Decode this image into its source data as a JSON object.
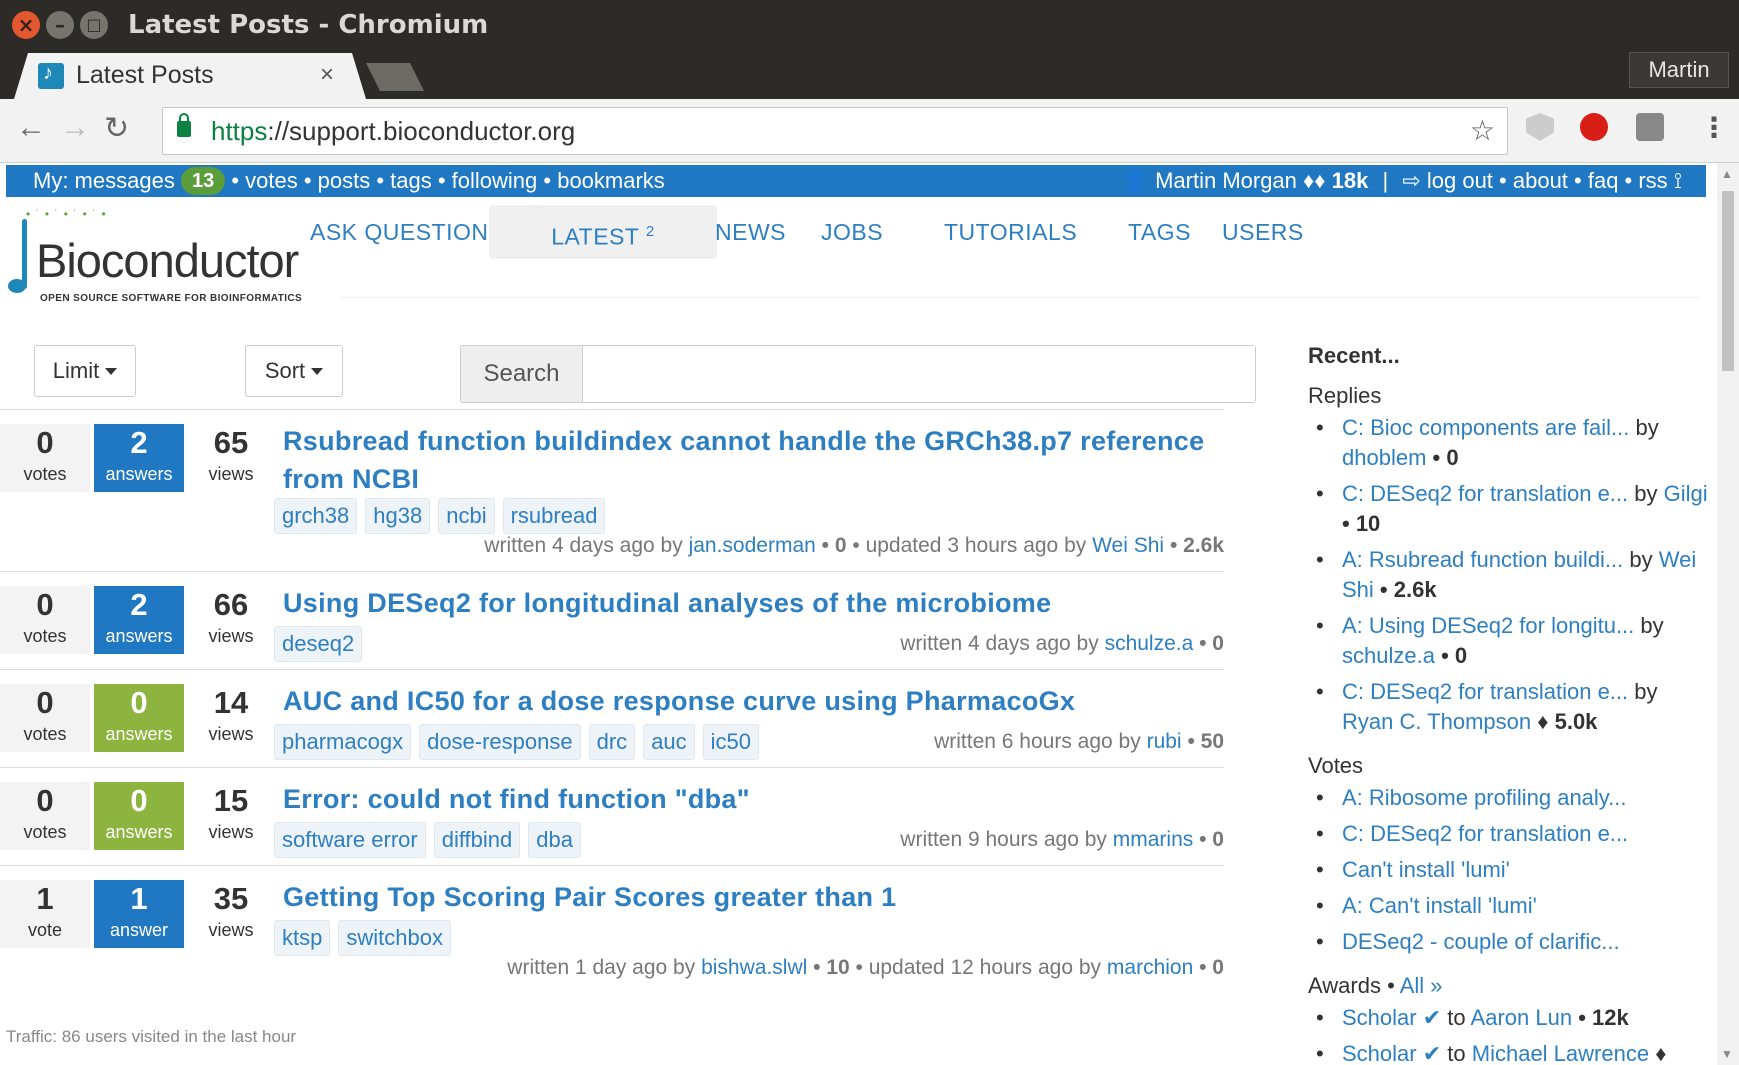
{
  "window": {
    "title": "Latest Posts - Chromium",
    "user": "Martin"
  },
  "tab": {
    "title": "Latest Posts"
  },
  "address": {
    "scheme": "https",
    "rest": "://support.bioconductor.org"
  },
  "topbar": {
    "my_label": "My: messages",
    "messages_count": "13",
    "links": "• votes • posts • tags • following • bookmarks",
    "user_name": "Martin Morgan",
    "user_rep": "♦♦ 18k",
    "separator": "|",
    "logout": "log out",
    "right_links": "• about • faq • rss"
  },
  "logo": {
    "name": "Bioconductor",
    "tagline": "OPEN SOURCE SOFTWARE FOR BIOINFORMATICS"
  },
  "nav": {
    "ask": "ASK QUESTION",
    "latest": "LATEST",
    "latest_count": "2",
    "news": "NEWS",
    "jobs": "JOBS",
    "tutorials": "TUTORIALS",
    "tags": "TAGS",
    "users": "USERS"
  },
  "filters": {
    "limit": "Limit",
    "sort": "Sort",
    "search_label": "Search",
    "search_value": ""
  },
  "posts": [
    {
      "votes": "0",
      "votes_label": "votes",
      "answers": "2",
      "answers_label": "answers",
      "views": "65",
      "views_label": "views",
      "title": "Rsubread function buildindex cannot handle the GRCh38.p7 reference from NCBI",
      "tags": [
        "grch38",
        "hg38",
        "ncbi",
        "rsubread"
      ],
      "meta_pre": "written 4 days ago by",
      "author": "jan.soderman",
      "author_score": "• 0",
      "meta_mid": "• updated 3 hours ago by",
      "updater": "Wei Shi",
      "updater_score": "• 2.6k"
    },
    {
      "votes": "0",
      "votes_label": "votes",
      "answers": "2",
      "answers_label": "answers",
      "views": "66",
      "views_label": "views",
      "title": "Using DESeq2 for longitudinal analyses of the microbiome",
      "tags": [
        "deseq2"
      ],
      "meta_pre": "written 4 days ago by",
      "author": "schulze.a",
      "author_score": "• 0"
    },
    {
      "votes": "0",
      "votes_label": "votes",
      "answers": "0",
      "answers_label": "answers",
      "views": "14",
      "views_label": "views",
      "title": "AUC and IC50 for a dose response curve using PharmacoGx",
      "tags": [
        "pharmacogx",
        "dose-response",
        "drc",
        "auc",
        "ic50"
      ],
      "meta_pre": "written 6 hours ago by",
      "author": "rubi",
      "author_score": "• 50"
    },
    {
      "votes": "0",
      "votes_label": "votes",
      "answers": "0",
      "answers_label": "answers",
      "views": "15",
      "views_label": "views",
      "title": "Error: could not find function \"dba\"",
      "tags": [
        "software error",
        "diffbind",
        "dba"
      ],
      "meta_pre": "written 9 hours ago by",
      "author": "mmarins",
      "author_score": "• 0"
    },
    {
      "votes": "1",
      "votes_label": "vote",
      "answers": "1",
      "answers_label": "answer",
      "views": "35",
      "views_label": "views",
      "title": "Getting Top Scoring Pair Scores greater than 1",
      "tags": [
        "ktsp",
        "switchbox"
      ],
      "meta_pre": "written 1 day ago by",
      "author": "bishwa.slwl",
      "author_score": "• 10",
      "meta_mid": "• updated 12 hours ago by",
      "updater": "marchion",
      "updater_score": "• 0"
    }
  ],
  "traffic": "Traffic: 86 users visited in the last hour",
  "sidebar": {
    "heading": "Recent...",
    "replies_label": "Replies",
    "replies": [
      {
        "link": "C: Bioc components are fail...",
        "by": "by",
        "user": "dhoblem",
        "score": "• 0"
      },
      {
        "link": "C: DESeq2 for translation e...",
        "by": "by",
        "user": "Gilgi",
        "score": "• 10"
      },
      {
        "link": "A: Rsubread function buildi...",
        "by": "by",
        "user": "Wei Shi",
        "score": "• 2.6k"
      },
      {
        "link": "A: Using DESeq2 for longitu...",
        "by": "by",
        "user": "schulze.a",
        "score": "• 0"
      },
      {
        "link": "C: DESeq2 for translation e...",
        "by": "by",
        "user": "Ryan C. Thompson",
        "score": "♦ 5.0k"
      }
    ],
    "votes_label": "Votes",
    "votes": [
      "A: Ribosome profiling analy...",
      "C: DESeq2 for translation e...",
      "Can't install 'lumi'",
      "A: Can't install 'lumi'",
      "DESeq2 - couple of clarific..."
    ],
    "awards_label": "Awards •",
    "awards_all": "All »",
    "awards": [
      {
        "award": "Scholar",
        "to": "to",
        "user": "Aaron Lun",
        "score": "• 12k"
      },
      {
        "award": "Scholar",
        "to": "to",
        "user": "Michael Lawrence",
        "score": "♦"
      }
    ]
  }
}
